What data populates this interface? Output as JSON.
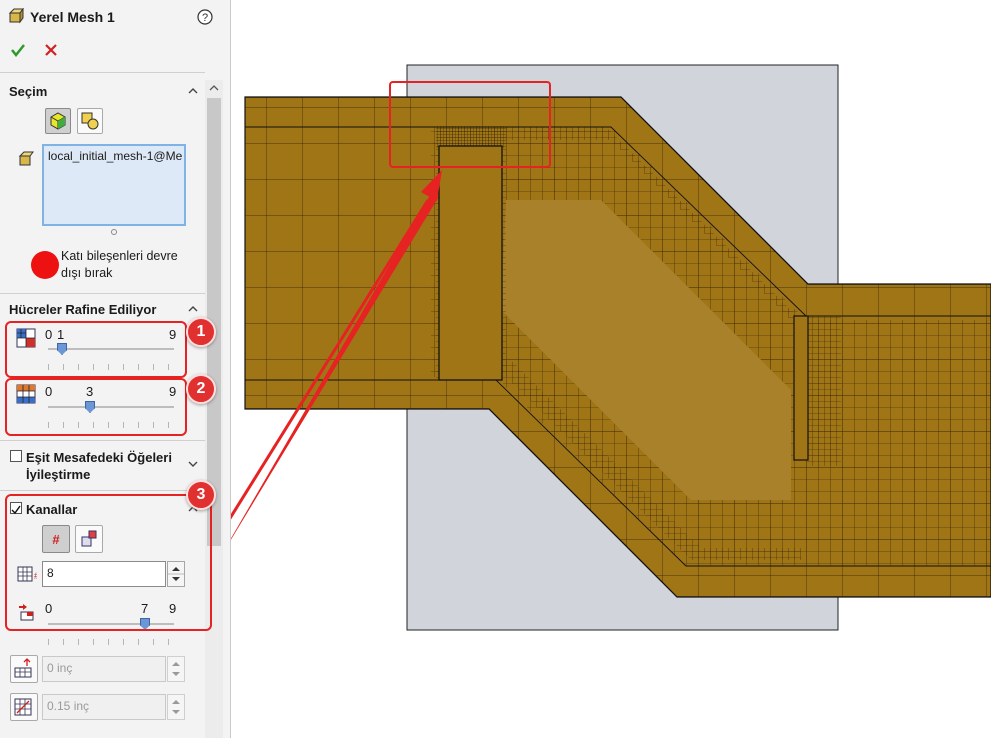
{
  "panel": {
    "title": "Yerel Mesh 1",
    "help_icon": "help-icon",
    "ok_icon": "checkmark-icon",
    "cancel_icon": "close-icon"
  },
  "selection": {
    "title": "Seçim",
    "list_item": "local_initial_mesh-1@Me",
    "disable_solids_label_1": "Katı bileşenleri devre",
    "disable_solids_label_2": "dışı bırak"
  },
  "refine": {
    "title": "Hücreler Rafine Ediliyor",
    "slider1": {
      "min": "0",
      "value": "1",
      "max": "9"
    },
    "slider2": {
      "min": "0",
      "value": "3",
      "max": "9"
    }
  },
  "equidistant": {
    "label_1": "Eşit Mesafedeki Öğeleri",
    "label_2": "İyileştirme",
    "checked": false
  },
  "channels": {
    "title": "Kanallar",
    "checked": true,
    "cells_value": "8",
    "slider": {
      "min": "0",
      "value": "7",
      "max": "9"
    },
    "min_height": "0 inç",
    "max_height": "0.15 inç"
  },
  "callouts": [
    "1",
    "2",
    "3"
  ],
  "colors": {
    "accent_red": "#e62222",
    "mesh_fill": "#a07516",
    "bbox_fill": "#d2d4dc"
  }
}
